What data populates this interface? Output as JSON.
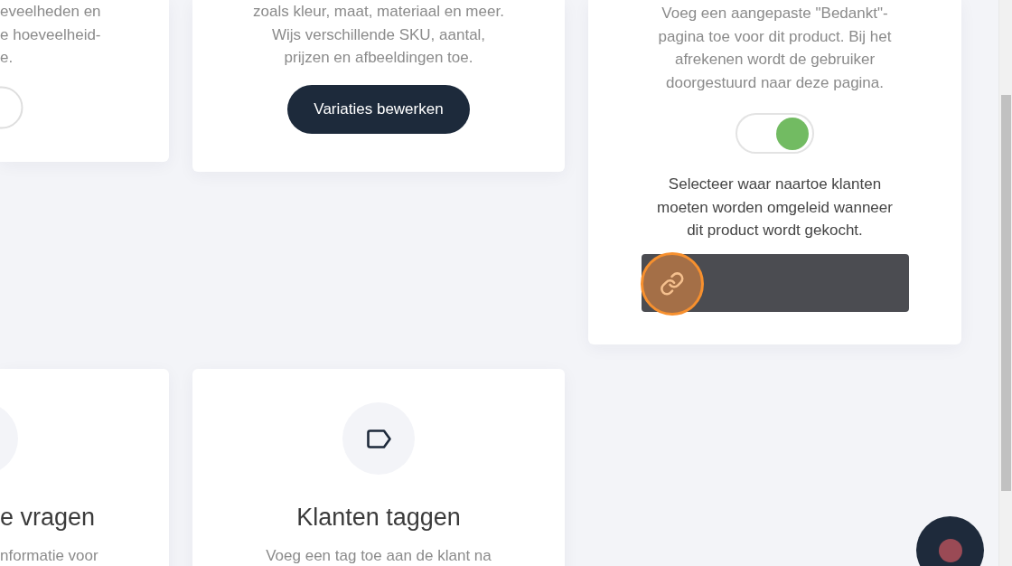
{
  "cards": [
    {
      "kind": "toggle_edge",
      "lines": [
        "eveelheden en",
        "e hoeveelheid-",
        "e."
      ],
      "toggle_on": false
    },
    {
      "kind": "button",
      "lines": [
        "zoals kleur, maat, materiaal en meer.",
        "Wijs verschillende SKU, aantal,",
        "prijzen en afbeeldingen toe."
      ],
      "button": "Variaties bewerken"
    },
    {
      "kind": "redirect",
      "lines": [
        "Voeg een aangepaste \"Bedankt\"-",
        "pagina toe voor dit product. Bij het",
        "afrekenen wordt de gebruiker",
        "doorgestuurd naar deze pagina."
      ],
      "toggle_on": true,
      "prompt_lines": [
        "Selecteer waar naartoe klanten",
        "moeten worden omgeleid wanneer",
        "dit product wordt gekocht."
      ],
      "link_field": {
        "highlighted": true
      }
    },
    {
      "kind": "feature_edge",
      "title": "e vragen",
      "lines": [
        "nformatie voor"
      ]
    },
    {
      "kind": "feature",
      "title": "Klanten taggen",
      "lines": [
        "Voeg een tag toe aan de klant na"
      ]
    }
  ]
}
